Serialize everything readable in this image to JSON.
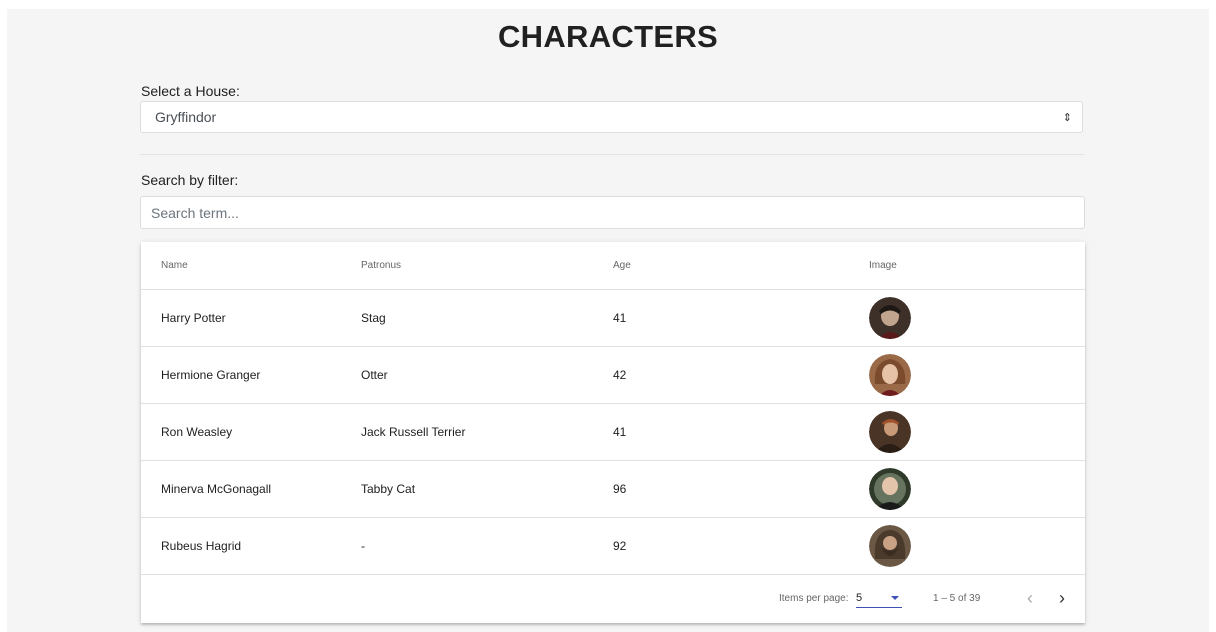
{
  "page": {
    "title": "CHARACTERS"
  },
  "house": {
    "label": "Select a House:",
    "selected": "Gryffindor"
  },
  "filter": {
    "label": "Search by filter:",
    "placeholder": "Search term...",
    "value": ""
  },
  "table": {
    "headers": {
      "name": "Name",
      "patronus": "Patronus",
      "age": "Age",
      "image": "Image"
    },
    "rows": [
      {
        "name": "Harry Potter",
        "patronus": "Stag",
        "age": "41",
        "avatar_color": "#3d3029"
      },
      {
        "name": "Hermione Granger",
        "patronus": "Otter",
        "age": "42",
        "avatar_color": "#9a6a48"
      },
      {
        "name": "Ron Weasley",
        "patronus": "Jack Russell Terrier",
        "age": "41",
        "avatar_color": "#4a3426"
      },
      {
        "name": "Minerva McGonagall",
        "patronus": "Tabby Cat",
        "age": "96",
        "avatar_color": "#2f3a2a"
      },
      {
        "name": "Rubeus Hagrid",
        "patronus": "-",
        "age": "92",
        "avatar_color": "#6b5844"
      }
    ]
  },
  "paginator": {
    "items_per_page_label": "Items per page:",
    "items_per_page": "5",
    "range": "1 – 5 of 39",
    "prev_icon": "chevron-left-icon",
    "next_icon": "chevron-right-icon"
  },
  "colors": {
    "accent": "#3f51b5",
    "background": "#f5f5f5"
  }
}
